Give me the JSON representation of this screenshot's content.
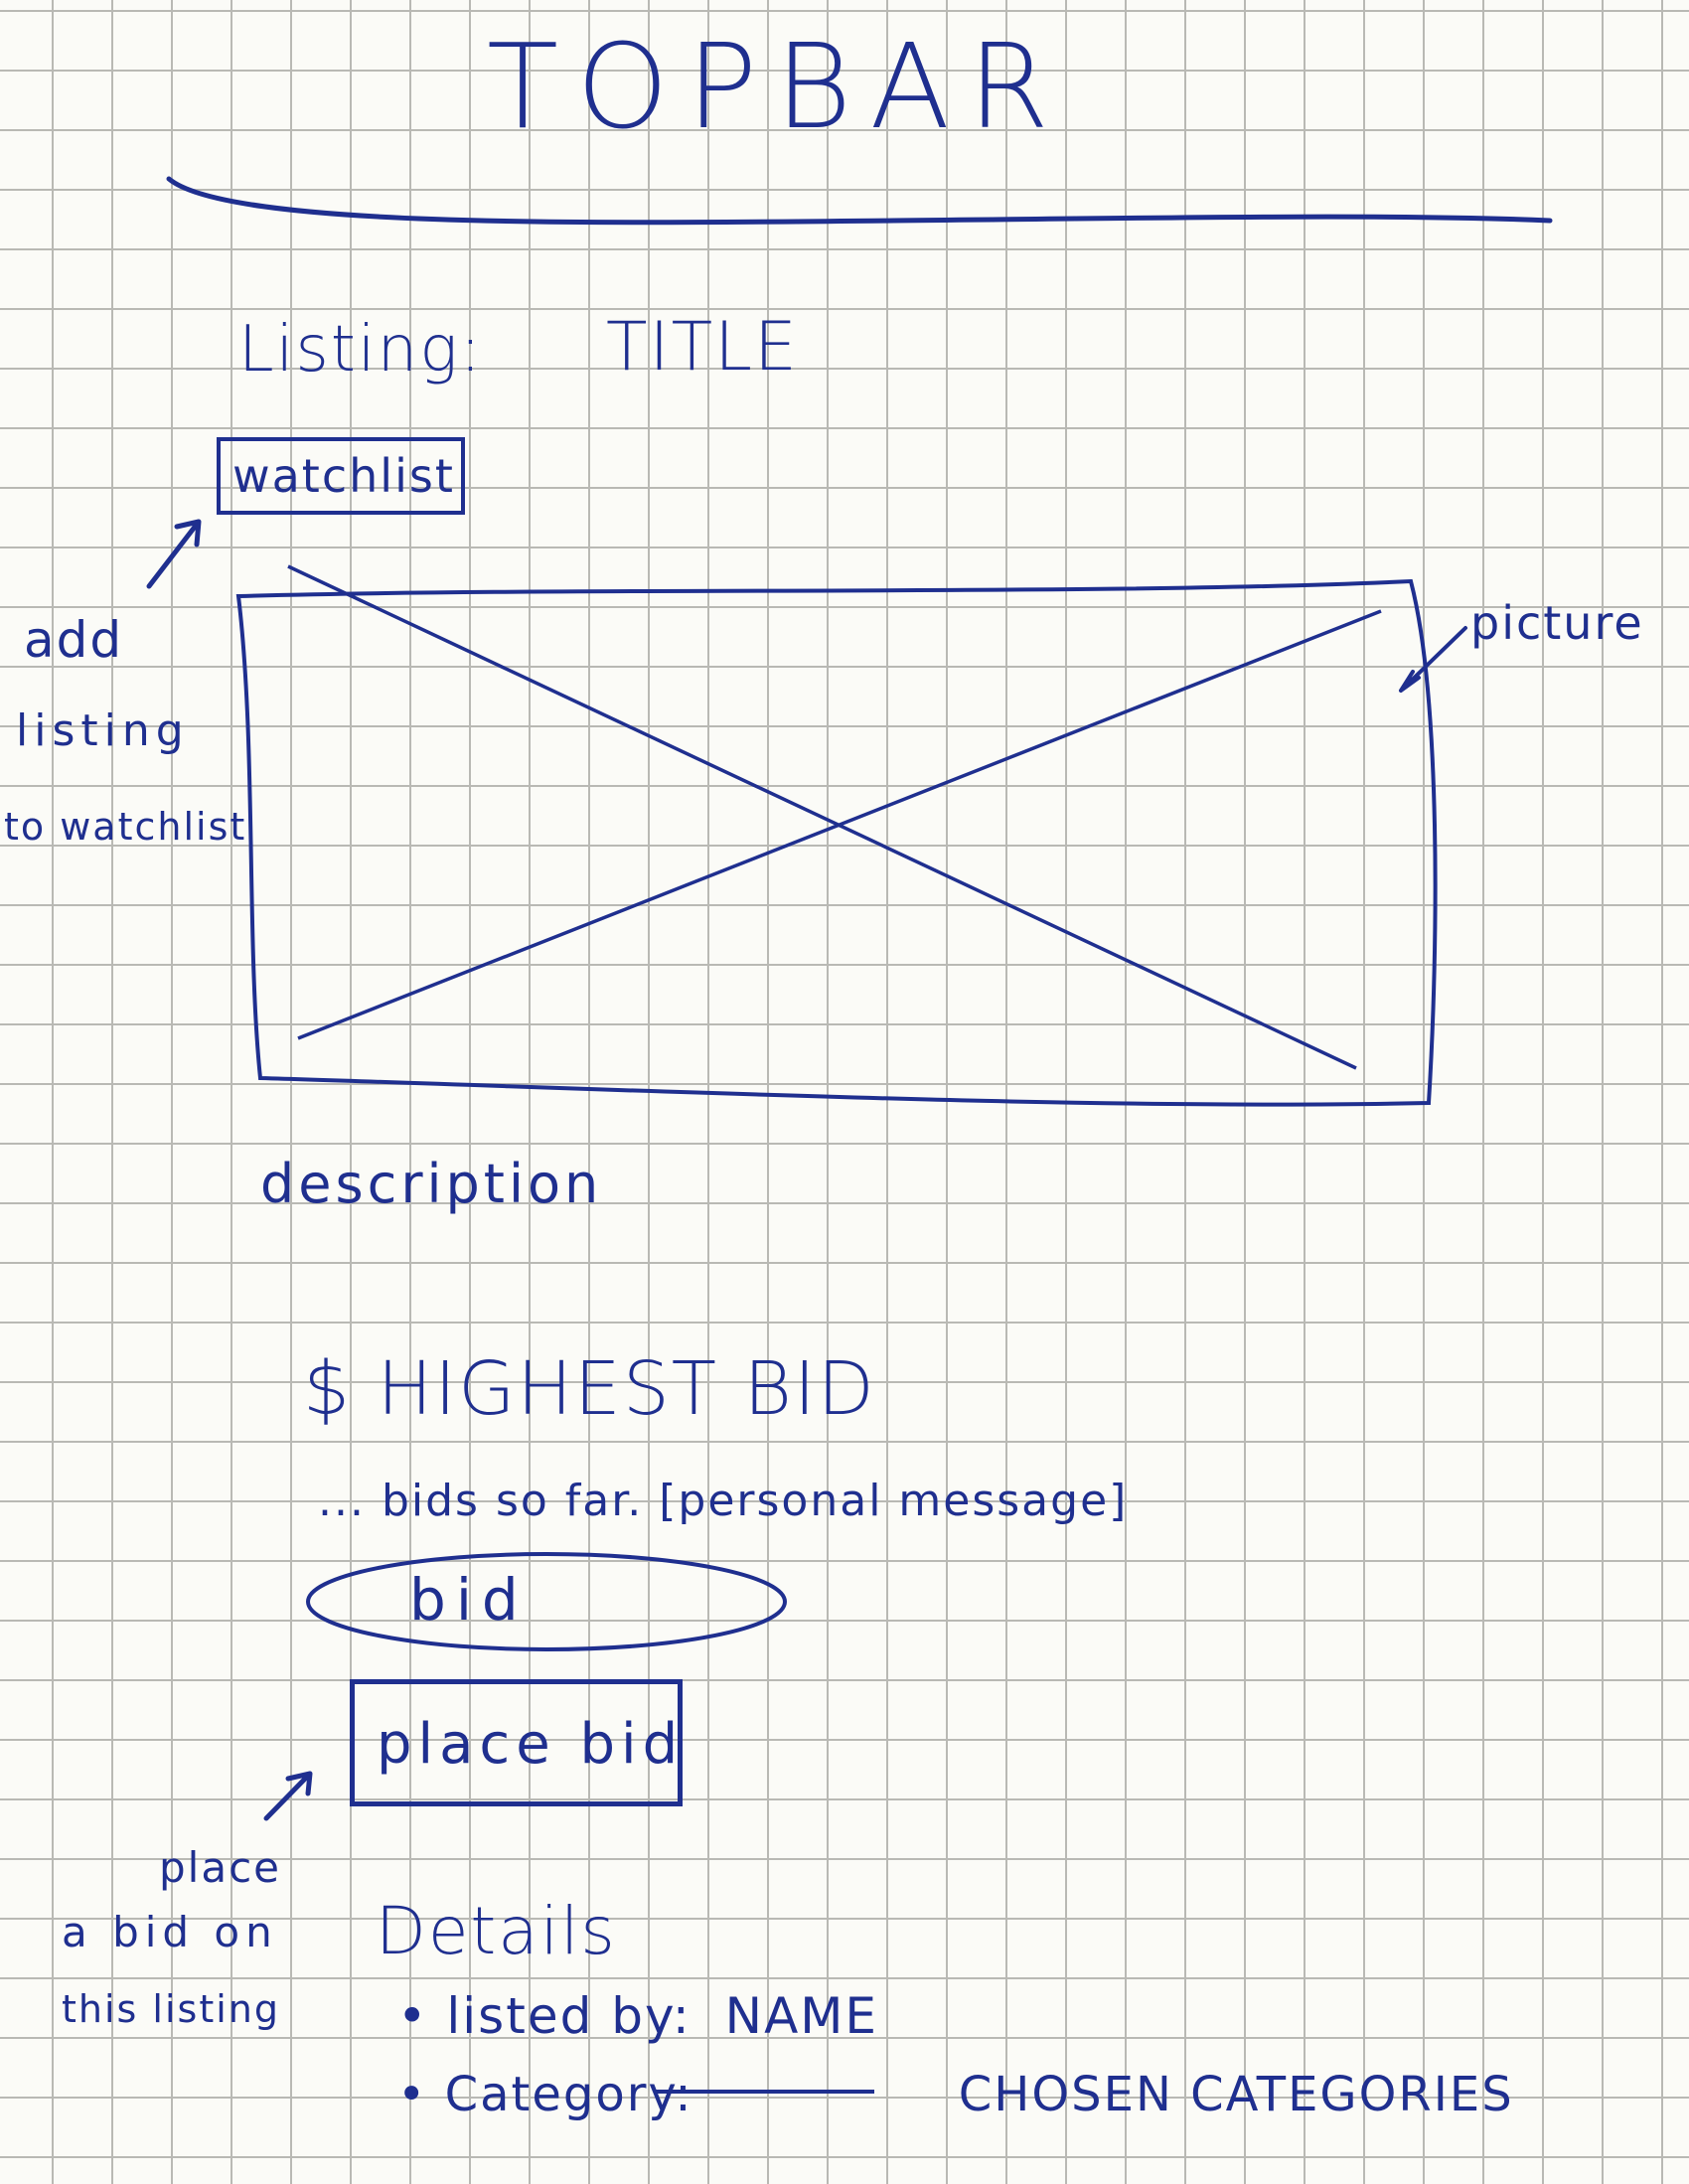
{
  "topbar": {
    "label": "TOPBAR"
  },
  "listing": {
    "heading_prefix": "Listing:",
    "title": "TITLE",
    "watchlist_button": "watchlist",
    "picture_label": "picture",
    "description": "description"
  },
  "annotations": {
    "watchlist_note": [
      "add",
      "listing",
      "to watchlist"
    ],
    "bid_note": [
      "place",
      "a bid on",
      "this listing"
    ]
  },
  "bidding": {
    "highest_bid": "$ HIGHEST BID",
    "bids_so_far": "... bids so far. [personal message]",
    "bid_input_placeholder": "bid",
    "place_bid_button": "place bid"
  },
  "details": {
    "heading": "Details",
    "items": [
      {
        "label": "listed by:",
        "value": "NAME"
      },
      {
        "label": "Category:",
        "value": "CHOSEN CATEGORIES"
      }
    ]
  },
  "colors": {
    "ink": "#1f2f8f",
    "grid": "#b9b9b4",
    "paper": "#fbfbf7"
  }
}
